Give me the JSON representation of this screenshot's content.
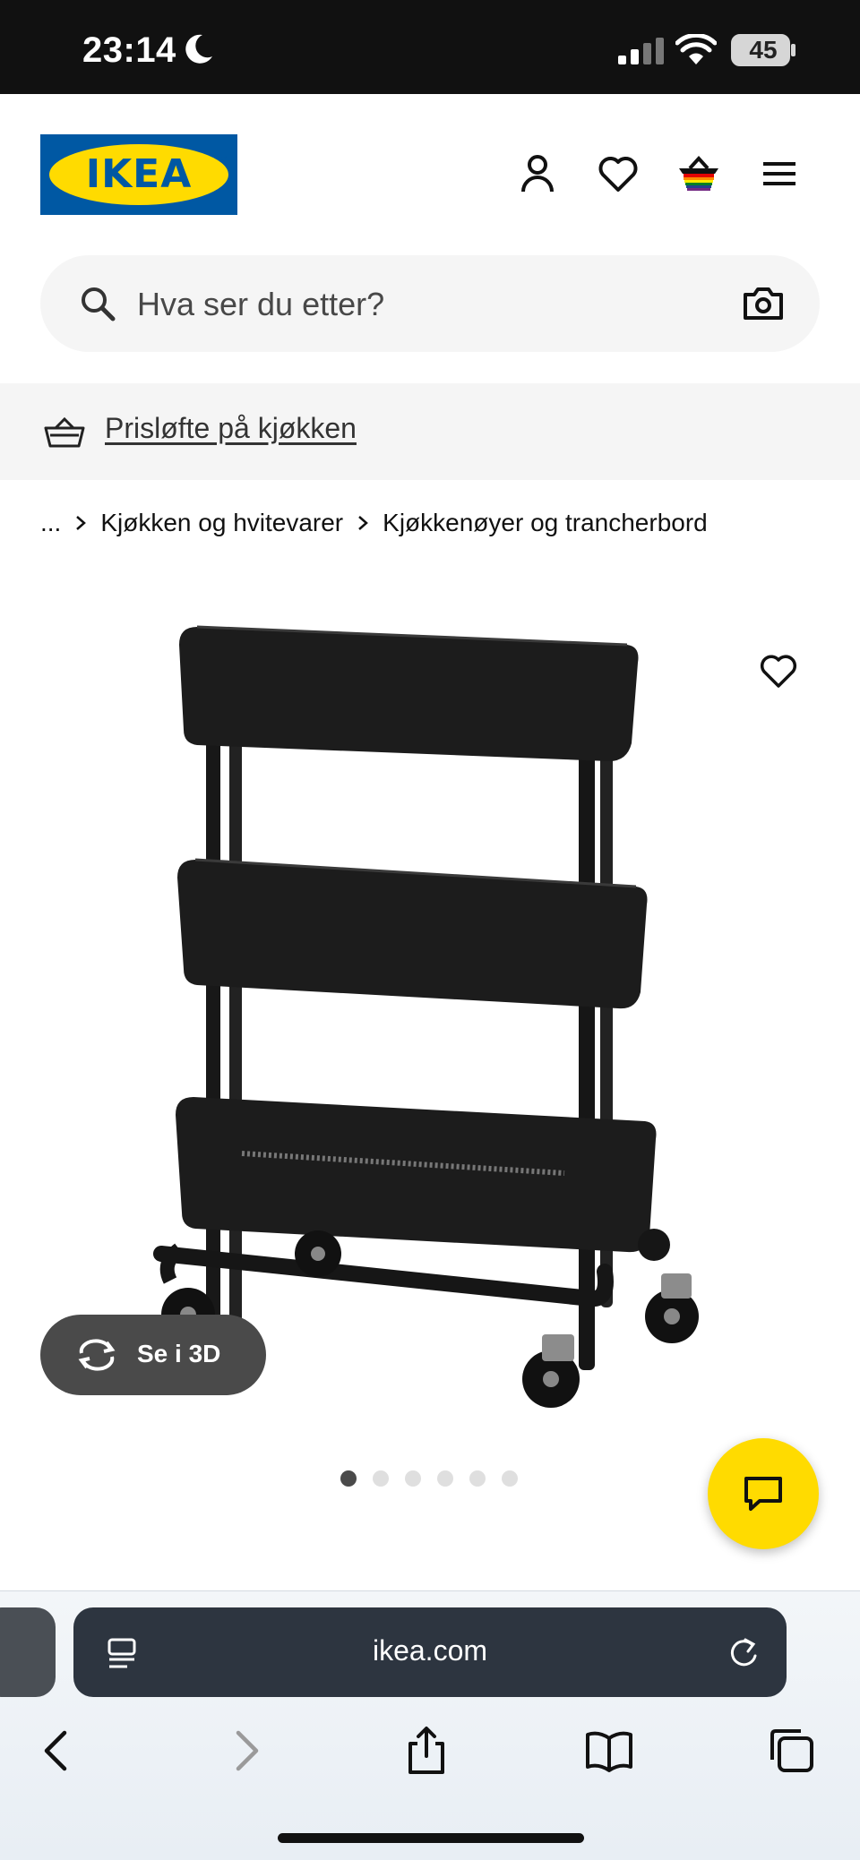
{
  "status_bar": {
    "time": "23:14",
    "battery": "45"
  },
  "header": {
    "logo_text": "IKEA",
    "icons": [
      "profile-icon",
      "heart-icon",
      "basket-icon",
      "menu-icon"
    ]
  },
  "search": {
    "placeholder": "Hva ser du etter?"
  },
  "promo": {
    "link_text": "Prisløfte på kjøkken"
  },
  "breadcrumb": {
    "ellipsis": "...",
    "items": [
      "Kjøkken og hvitevarer",
      "Kjøkkenøyer og trancherbord"
    ]
  },
  "product": {
    "image_alt_name": "black-three-tier-kitchen-trolley",
    "view_3d_label": "Se i 3D",
    "carousel": {
      "count": 6,
      "active_index": 0
    }
  },
  "browser": {
    "url": "ikea.com"
  },
  "colors": {
    "brand_blue": "#0058a3",
    "brand_yellow": "#ffdb00",
    "status_bar": "#111111",
    "url_bar": "#2d3540"
  }
}
